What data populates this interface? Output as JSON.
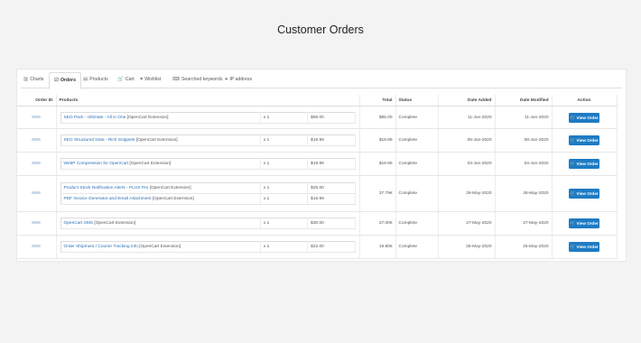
{
  "page": {
    "title": "Customer Orders"
  },
  "tabs": [
    {
      "label": "Charts",
      "icon": "bar-chart-icon",
      "active": false
    },
    {
      "label": "Orders",
      "icon": "checkbox-icon",
      "active": true
    },
    {
      "label": "Products",
      "icon": "list-icon",
      "active": false
    },
    {
      "label": "Cart",
      "icon": "cart-icon",
      "active": false
    },
    {
      "label": "Wishlist",
      "icon": "heart-icon",
      "active": false
    },
    {
      "label": "Searched keywords",
      "icon": "keyboard-icon",
      "active": false
    },
    {
      "label": "IP address",
      "icon": "globe-icon",
      "active": false
    }
  ],
  "table": {
    "headers": {
      "order_id": "Order ID",
      "products": "Products",
      "total": "Total",
      "status": "Status",
      "date_added": "Date Added",
      "date_modified": "Date Modified",
      "action": "Action"
    },
    "view_label": "View Order",
    "rows": [
      {
        "products": [
          {
            "name": "SEO Pack - Ultimate - All in One",
            "ext": " [OpenCart Extension]",
            "qty": "x 1",
            "price": "$85.00"
          }
        ],
        "total": "$85.00",
        "status": "Complete",
        "date_added": "11-Jun-2020",
        "date_modified": "11-Jun-2020"
      },
      {
        "products": [
          {
            "name": "SEO Structured Data - Rich Snippets",
            "ext": " [OpenCart Extension]",
            "qty": "x 1",
            "price": "$19.99"
          }
        ],
        "total": "$19.99",
        "status": "Complete",
        "date_added": "06-Jun-2020",
        "date_modified": "08-Jun-2020"
      },
      {
        "products": [
          {
            "name": "WebP Compression for OpenCart",
            "ext": " [OpenCart Extension]",
            "qty": "x 1",
            "price": "$19.99"
          }
        ],
        "total": "$19.99",
        "status": "Complete",
        "date_added": "04-Jun-2020",
        "date_modified": "04-Jun-2020"
      },
      {
        "products": [
          {
            "name": "Product Stock Notification Alerts - PLUS Pro",
            "ext": " [OpenCart Extension]",
            "qty": "x 1",
            "price": "$25.00"
          },
          {
            "name": "PDF Invoice Generator and Email Attachment",
            "ext": " [OpenCart Extension]",
            "qty": "x 1",
            "price": "$16.99"
          }
        ],
        "total": "37.79€",
        "status": "Complete",
        "date_added": "28-May-2020",
        "date_modified": "28-May-2020"
      },
      {
        "products": [
          {
            "name": "OpenCart SMS",
            "ext": " [OpenCart Extension]",
            "qty": "x 1",
            "price": "$30.00"
          }
        ],
        "total": "27.00€",
        "status": "Complete",
        "date_added": "27-May-2020",
        "date_modified": "27-May-2020"
      },
      {
        "products": [
          {
            "name": "Order Shipment / Courier Tracking Info",
            "ext": " [OpenCart Extension]",
            "qty": "x 1",
            "price": "$22.00"
          }
        ],
        "total": "19.80€",
        "status": "Complete",
        "date_added": "25-May-2020",
        "date_modified": "25-May-2020"
      }
    ]
  },
  "colors": {
    "accent": "#1e7bc3",
    "link": "#2a6fb4",
    "background": "#f3f3f3"
  }
}
